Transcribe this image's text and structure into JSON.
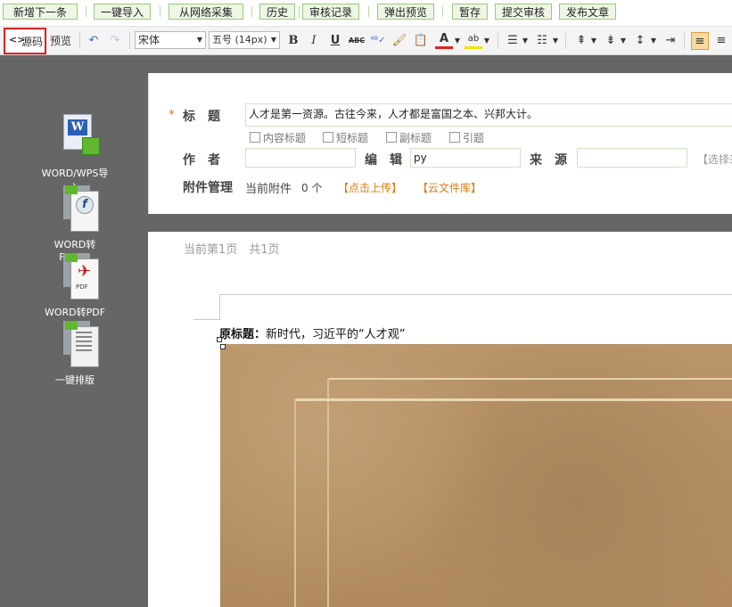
{
  "topbar": {
    "buttons": [
      "新增下一条",
      "一键导入",
      "从网络采集",
      "历史",
      "审核记录",
      "弹出预览",
      "暂存",
      "提交审核",
      "发布文章"
    ]
  },
  "toolbar": {
    "source_label": "源码",
    "source_icon": "<>",
    "preview_label": "预览",
    "font_family": "宋体",
    "font_size": "五号 (14px)",
    "bold": "B",
    "italic": "I",
    "underline": "U",
    "strike": "ABC",
    "font_color_glyph": "A",
    "highlight_glyph": "ab",
    "font_color": "#e02020",
    "highlight_color": "#f6e100"
  },
  "left_panel": {
    "items": [
      "WORD/WPS导入",
      "WORD转FLASH",
      "WORD转PDF",
      "一键排版"
    ]
  },
  "form": {
    "required_mark": "*",
    "title_label": "标　题",
    "title_value": "人才是第一资源。古往今来，人才都是富国之本、兴邦大计。",
    "checkboxes": [
      "内容标题",
      "短标题",
      "副标题",
      "引题"
    ],
    "author_label": "作　者",
    "author_value": "",
    "editor_label": "编　辑",
    "editor_value": "py",
    "source_label": "来　源",
    "source_value": "",
    "source_select": "【选择来",
    "attachment_label": "附件管理",
    "current_attachment": "当前附件",
    "attachment_count": "0 个",
    "upload_link": "【点击上传】",
    "cloud_link": "【云文件库】"
  },
  "doc": {
    "page_info": "当前第1页　共1页",
    "original_title_label": "原标题：",
    "original_title": "新时代，习近平的“人才观”"
  },
  "colors": {
    "left_panel": "#666666",
    "button_bg": "#eef6e6",
    "button_border": "#9ac97a",
    "highlight_box": "#e02020",
    "accent_orange": "#e07a10"
  }
}
